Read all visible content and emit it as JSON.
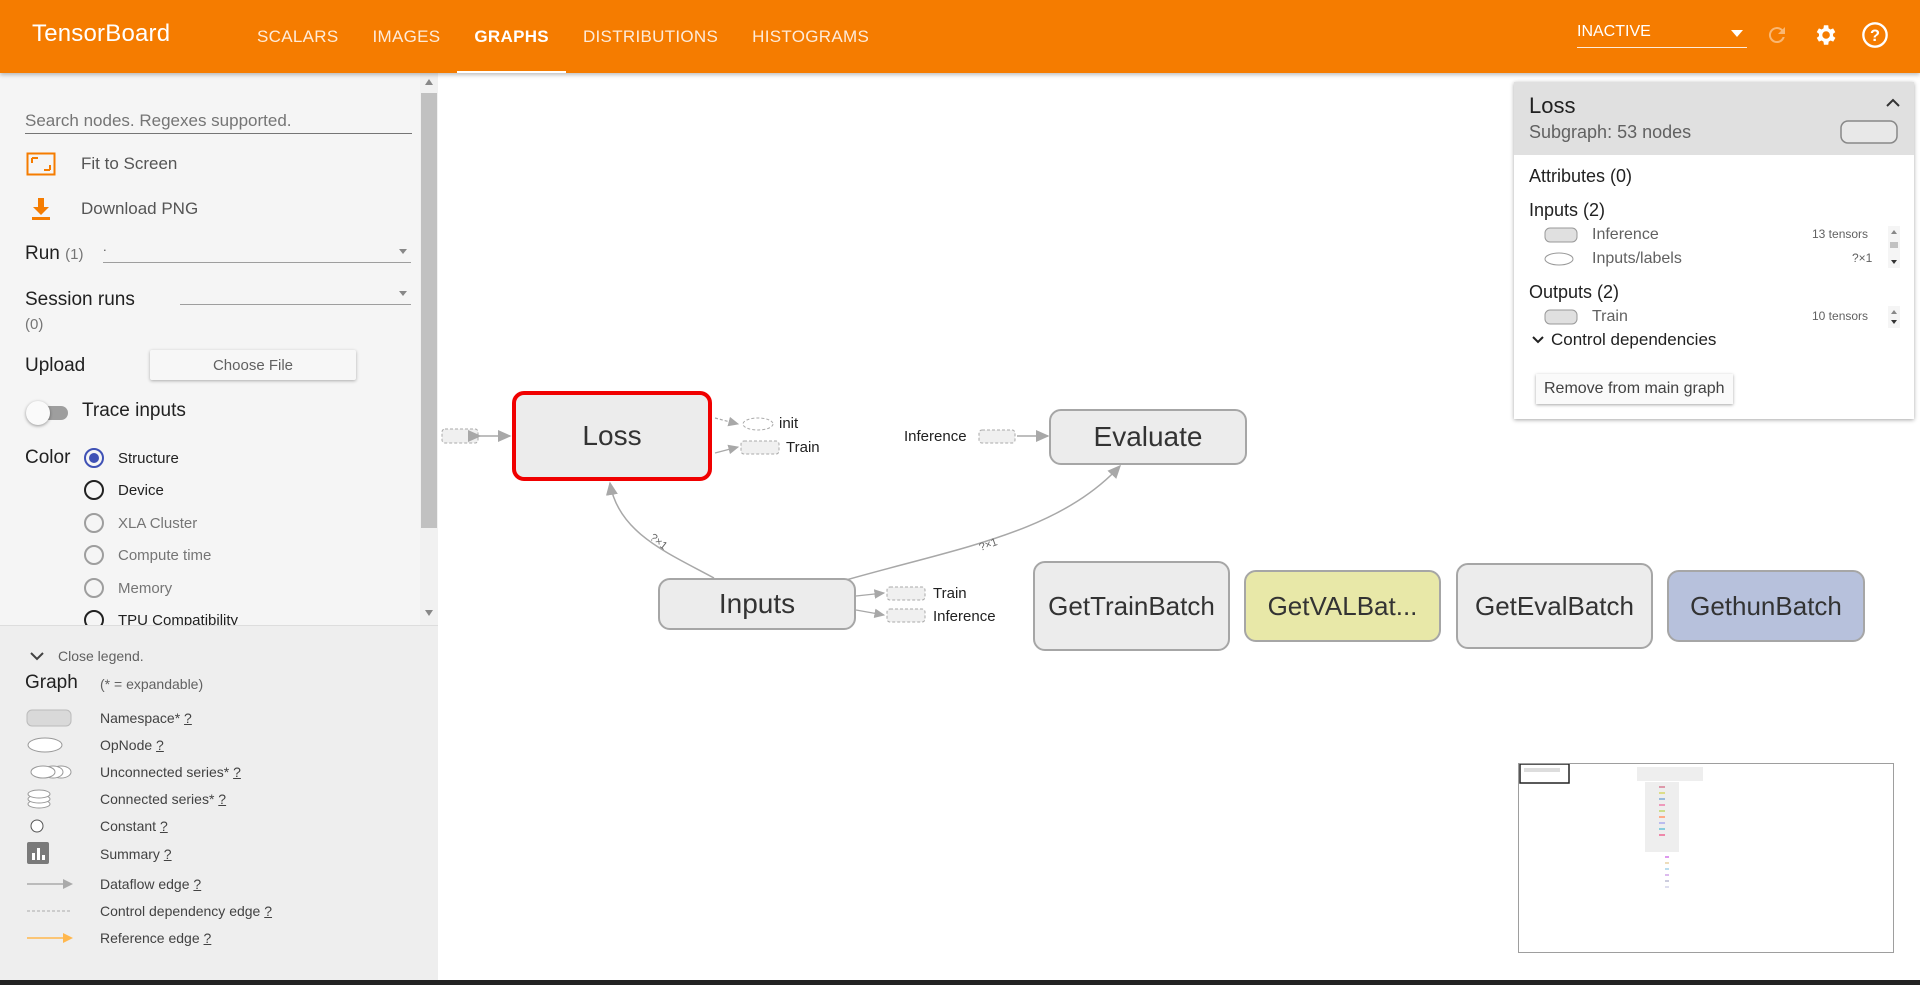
{
  "app": {
    "title": "TensorBoard"
  },
  "tabs": [
    {
      "label": "SCALARS",
      "active": false
    },
    {
      "label": "IMAGES",
      "active": false
    },
    {
      "label": "GRAPHS",
      "active": true
    },
    {
      "label": "DISTRIBUTIONS",
      "active": false
    },
    {
      "label": "HISTOGRAMS",
      "active": false
    }
  ],
  "toolbar": {
    "status_select": "INACTIVE",
    "reload_icon": "reload-icon",
    "settings_icon": "gear-icon",
    "help_icon": "help-icon"
  },
  "sidebar": {
    "search_placeholder": "Search nodes. Regexes supported.",
    "fit_to_screen": "Fit to Screen",
    "download_png": "Download PNG",
    "run_label": "Run",
    "run_count": "(1)",
    "run_value": ".",
    "session_runs_label": "Session runs",
    "session_runs_count": "(0)",
    "upload_label": "Upload",
    "choose_file": "Choose File",
    "trace_inputs": "Trace inputs",
    "color_label": "Color",
    "color_options": [
      {
        "label": "Structure",
        "selected": true
      },
      {
        "label": "Device",
        "selected": false
      },
      {
        "label": "XLA Cluster",
        "selected": false
      },
      {
        "label": "Compute time",
        "selected": false
      },
      {
        "label": "Memory",
        "selected": false
      },
      {
        "label": "TPU Compatibility",
        "selected": false
      }
    ]
  },
  "legend": {
    "close": "Close legend.",
    "title": "Graph",
    "subtitle": "(* = expandable)",
    "help_mark": "?",
    "items": [
      {
        "label": "Namespace*"
      },
      {
        "label": "OpNode"
      },
      {
        "label": "Unconnected series*"
      },
      {
        "label": "Connected series*"
      },
      {
        "label": "Constant"
      },
      {
        "label": "Summary"
      },
      {
        "label": "Dataflow edge"
      },
      {
        "label": "Control dependency edge"
      },
      {
        "label": "Reference edge"
      }
    ]
  },
  "graph": {
    "nodes": {
      "loss": "Loss",
      "evaluate": "Evaluate",
      "inputs": "Inputs",
      "get_train_batch": "GetTrainBatch",
      "get_val_batch": "GetVALBat...",
      "get_eval_batch": "GetEvalBatch",
      "gethun_batch": "GethunBatch"
    },
    "labels": {
      "init": "init",
      "loss_train": "Train",
      "inference_in": "Inference",
      "inputs_train": "Train",
      "inputs_inference": "Inference",
      "edge_shape_1": "?×1",
      "edge_shape_2": "?×1"
    },
    "colors": {
      "selected_border": "#f00000",
      "val_fill": "#e8e8a8",
      "hun_fill": "#b7c1dc"
    }
  },
  "info": {
    "title": "Loss",
    "subtitle": "Subgraph: 53 nodes",
    "attributes": "Attributes (0)",
    "inputs_header": "Inputs (2)",
    "inputs": [
      {
        "name": "Inference",
        "count": "13 tensors"
      },
      {
        "name": "Inputs/labels",
        "count": "?×1"
      }
    ],
    "outputs_header": "Outputs (2)",
    "outputs": [
      {
        "name": "Train",
        "count": "10 tensors"
      }
    ],
    "control_deps": "Control dependencies",
    "remove_button": "Remove from main graph"
  },
  "colors": {
    "topbar": "#f57c00",
    "accent": "#f57c00",
    "radio_selected": "#3f51b5"
  }
}
